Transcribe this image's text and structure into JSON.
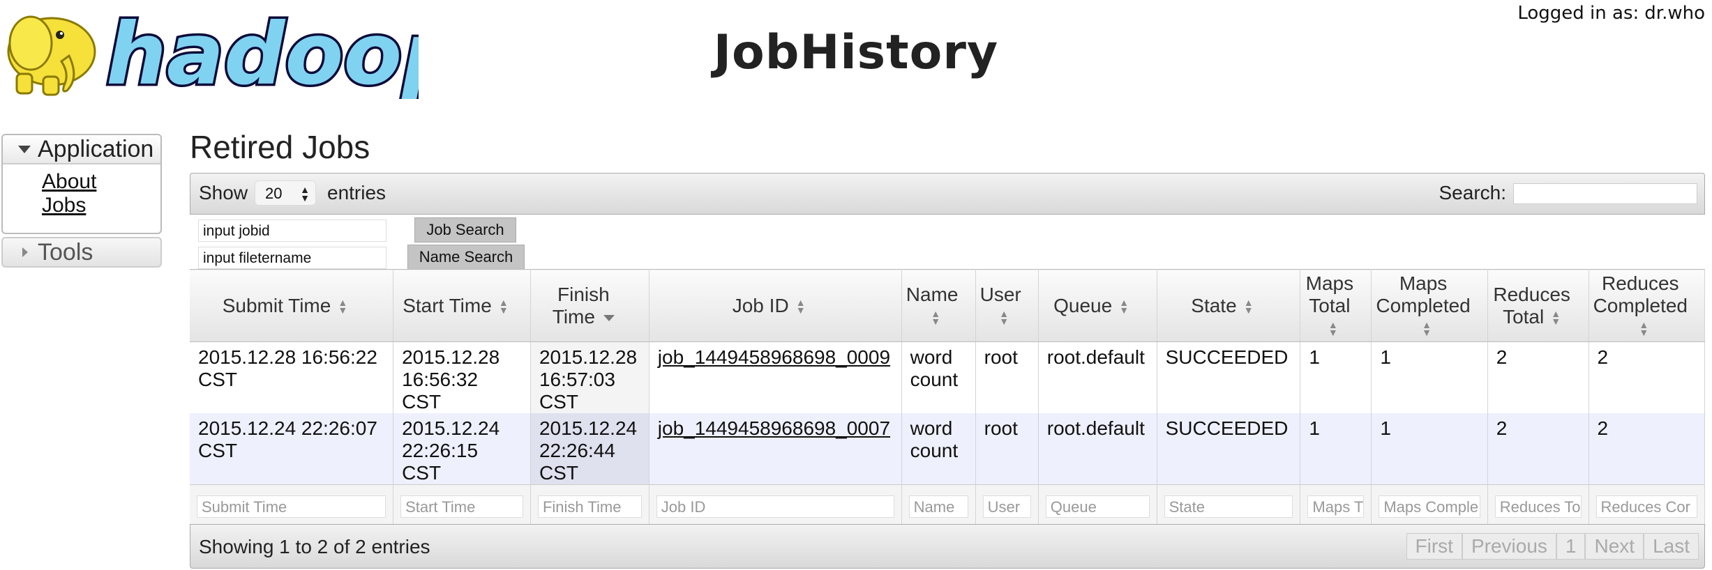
{
  "header": {
    "logo_text": "hadoop",
    "title": "JobHistory",
    "login_label": "Logged in as:",
    "login_user": "dr.who"
  },
  "nav": {
    "application_label": "Application",
    "links": [
      "About",
      "Jobs"
    ],
    "tools_label": "Tools"
  },
  "main": {
    "section_title": "Retired Jobs",
    "show_label": "Show",
    "entries_select_value": "20",
    "entries_label": "entries",
    "search_label": "Search:",
    "jobid_input_value": "input jobid",
    "filename_input_value": "input fileternаme",
    "job_search_button": "Job Search",
    "name_search_button": "Name Search"
  },
  "table": {
    "columns": [
      "Submit Time",
      "Start Time",
      "Finish Time",
      "Job ID",
      "Name",
      "User",
      "Queue",
      "State",
      "Maps Total",
      "Maps Completed",
      "Reduces Total",
      "Reduces Completed"
    ],
    "rows": [
      [
        "2015.12.28 16:56:22 CST",
        "2015.12.28 16:56:32 CST",
        "2015.12.28 16:57:03 CST",
        "job_1449458968698_0009",
        "word count",
        "root",
        "root.default",
        "SUCCEEDED",
        "1",
        "1",
        "2",
        "2"
      ],
      [
        "2015.12.24 22:26:07 CST",
        "2015.12.24 22:26:15 CST",
        "2015.12.24 22:26:44 CST",
        "job_1449458968698_0007",
        "word count",
        "root",
        "root.default",
        "SUCCEEDED",
        "1",
        "1",
        "2",
        "2"
      ]
    ],
    "footer_placeholders": [
      "Submit Time",
      "Start Time",
      "Finish Time",
      "Job ID",
      "Name",
      "User",
      "Queue",
      "State",
      "Maps T",
      "Maps Comple",
      "Reduces To",
      "Reduces Cor"
    ]
  },
  "footer": {
    "info": "Showing 1 to 2 of 2 entries",
    "first": "First",
    "previous": "Previous",
    "page": "1",
    "next": "Next",
    "last": "Last"
  }
}
